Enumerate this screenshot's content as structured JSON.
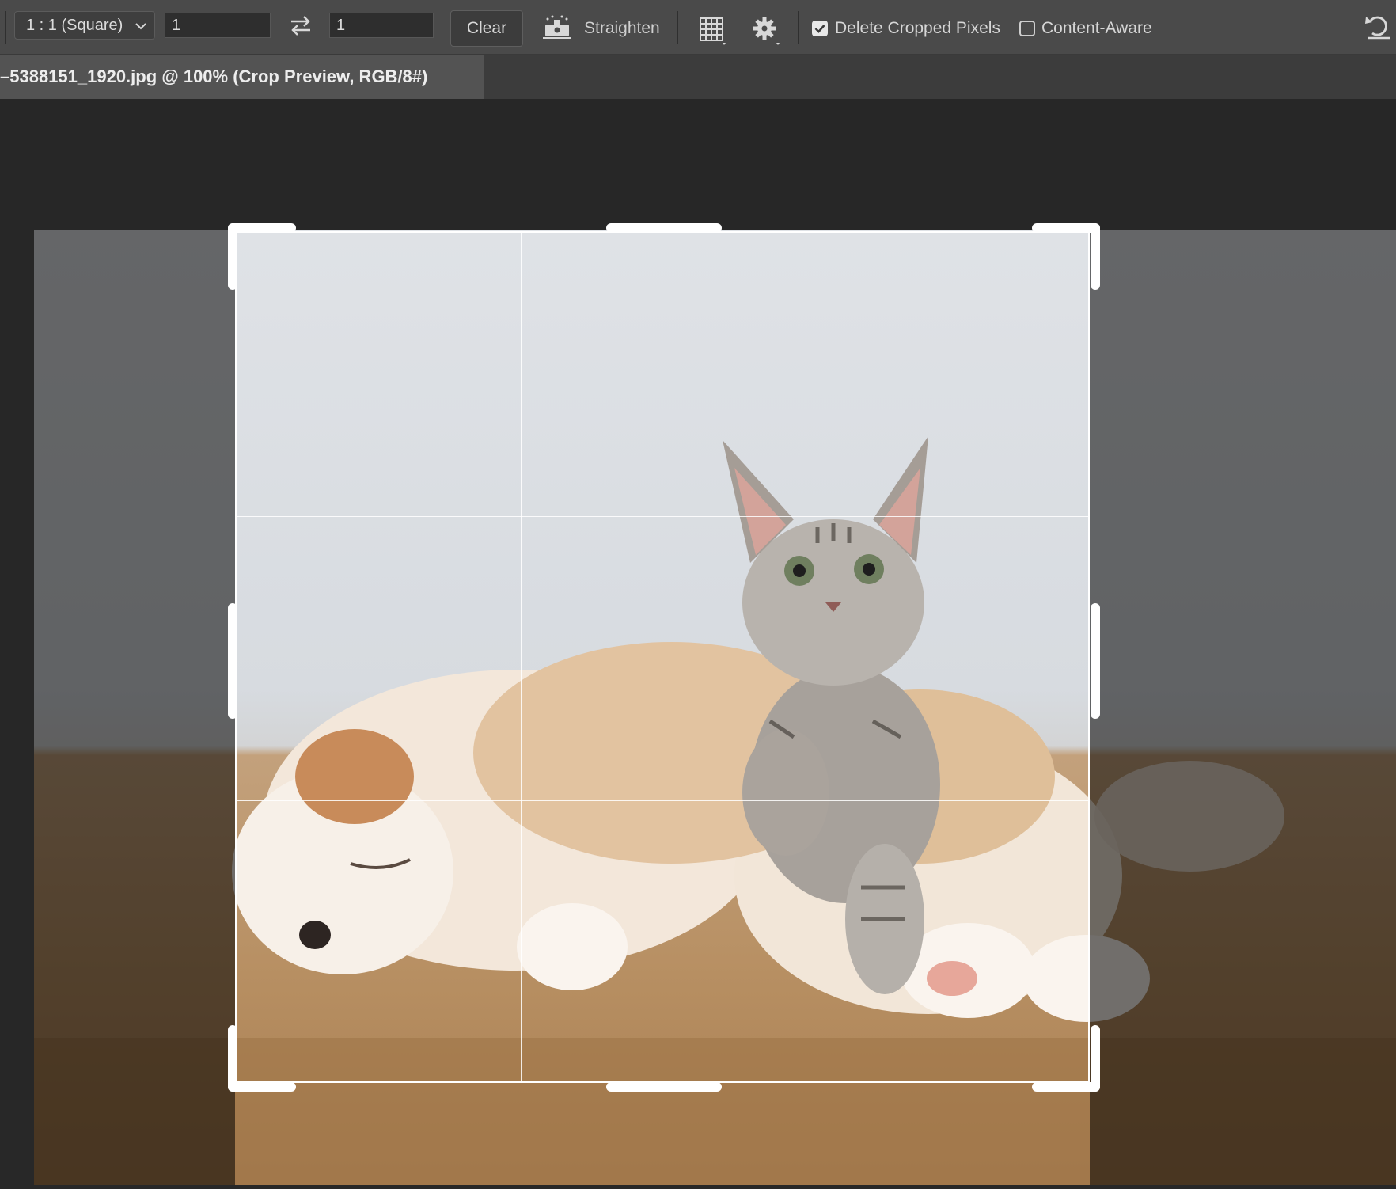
{
  "options_bar": {
    "ratio_preset": "1 : 1 (Square)",
    "width_value": "1",
    "height_value": "1",
    "clear_label": "Clear",
    "straighten_label": "Straighten",
    "delete_cropped_label": "Delete Cropped Pixels",
    "delete_cropped_checked": true,
    "content_aware_label": "Content-Aware",
    "content_aware_checked": false
  },
  "document": {
    "tab_title": "–5388151_1920.jpg @ 100% (Crop Preview, RGB/8#)"
  },
  "colors": {
    "options_bar_bg": "#4a4a4a",
    "tab_active_bg": "#535353",
    "canvas_bg": "#272727",
    "crop_border": "#ffffff"
  },
  "icons": [
    "chevron-down-icon",
    "swap-arrows-icon",
    "straighten-level-icon",
    "grid-overlay-icon",
    "gear-icon",
    "reset-icon"
  ]
}
